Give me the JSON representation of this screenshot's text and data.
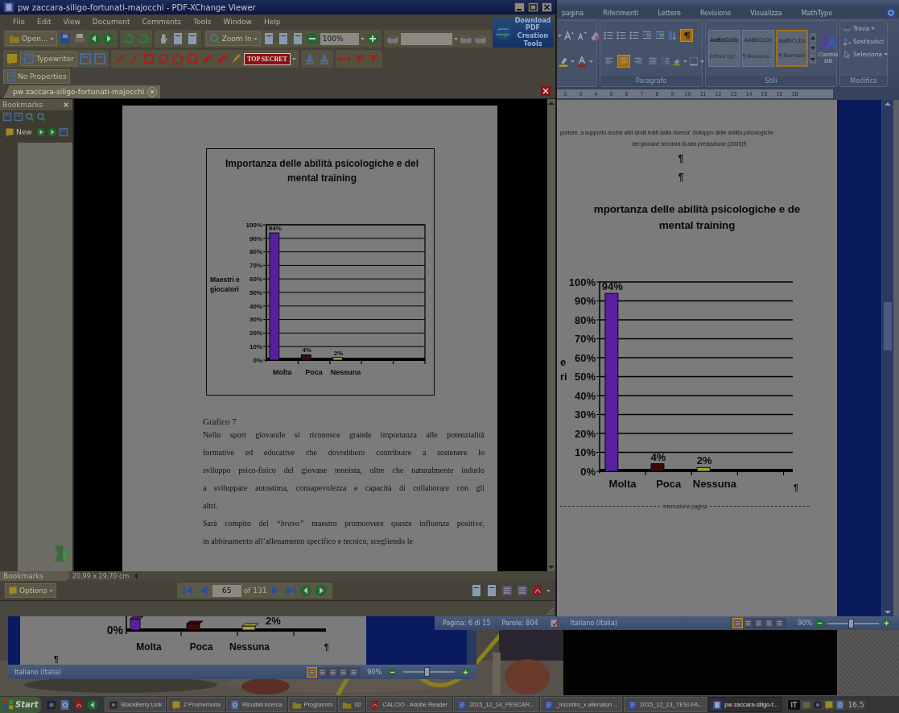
{
  "pdf_viewer": {
    "title": "pw zaccara-siligo-fortunati-majocchi - PDF-XChange Viewer",
    "menu": [
      "File",
      "Edit",
      "View",
      "Document",
      "Comments",
      "Tools",
      "Window",
      "Help"
    ],
    "open_button": "Open...",
    "zoom_button": "Zoom In",
    "zoom_value": "100%",
    "typewriter_button": "Typewriter",
    "stamp_button": "TOP SECRET",
    "properties_button": "No Properties",
    "promo": "Download PDF Creation Tools",
    "tabs": [
      {
        "label": "pw zaccara-siligo-fortunati-majocchi",
        "selected": true
      }
    ],
    "bookmarks": {
      "title": "Bookmarks",
      "new_button": "New",
      "tab": "Bookmarks"
    },
    "page": {
      "chart_data": {
        "type": "bar",
        "grid": true,
        "title": "Importanza delle abilità psicologiche e del\nmental training",
        "ylabel": "Maestri e\ngiocatori",
        "categories": [
          "Molta",
          "Poca",
          "Nessuna"
        ],
        "values": [
          94,
          4,
          2
        ],
        "colors": [
          "#5a1fa0",
          "#3c0a0a",
          "#a8a040"
        ],
        "ylim": [
          0,
          100
        ],
        "yticks": [
          {
            "value": 0,
            "label": "0%"
          },
          {
            "value": 10,
            "label": "10%"
          },
          {
            "value": 20,
            "label": "20%"
          },
          {
            "value": 30,
            "label": "30%"
          },
          {
            "value": 40,
            "label": "40%"
          },
          {
            "value": 50,
            "label": "50%"
          },
          {
            "value": 60,
            "label": "60%"
          },
          {
            "value": 70,
            "label": "70%"
          },
          {
            "value": 80,
            "label": "80%"
          },
          {
            "value": 90,
            "label": "90%"
          },
          {
            "value": 100,
            "label": "100%"
          }
        ],
        "value_labels": [
          "94%",
          "4%",
          "2%"
        ]
      },
      "caption": "Grafico 7",
      "paragraphs": [
        {
          "lines": [
            "Nello sport giovanile si riconosce grande importanza alle potenzialità",
            "formative ed educative che dovrebbero contribuire a sostenere lo",
            "sviluppo psico-fisico del giovane tennista, oltre che naturalmente indurlo",
            "a sviluppare autostima, consapevolezza e capacità di collaborare con gli",
            "altri."
          ]
        },
        {
          "lines": [
            "Sarà compito del *“bravo”* maestro promuovere queste influenze positive,",
            "in abbinamento all’allenamento specifico e tecnico, scegliendo le"
          ]
        }
      ]
    },
    "page_size": "20,99 x 29,70 cm",
    "options_button": "Options",
    "page_number": "65",
    "page_count": "of 131"
  },
  "word": {
    "tabs": [
      {
        "label": "pagina",
        "selected": false
      },
      {
        "label": "Riferimenti",
        "selected": false
      },
      {
        "label": "Lettere",
        "selected": false
      },
      {
        "label": "Revisione",
        "selected": false
      },
      {
        "label": "Visualizza",
        "selected": false
      },
      {
        "label": "MathType",
        "selected": false
      }
    ],
    "formatting_marks": {
      "on": true
    },
    "alignment": [
      {
        "kind": "left",
        "selected": false
      },
      {
        "kind": "center",
        "selected": true
      },
      {
        "kind": "right",
        "selected": false
      },
      {
        "kind": "justify",
        "selected": false
      }
    ],
    "groups": [
      "Paragrafo",
      "Stili",
      "Modifica"
    ],
    "styles": [
      {
        "preview": "AaBbCcDc",
        "name": "Enfasi (gr...",
        "bold": true,
        "selected": false
      },
      {
        "preview": "AaBbCcDc",
        "name": "¶ Nessuna...",
        "bold": false,
        "selected": false
      },
      {
        "preview": "AaBbCcDc",
        "name": "¶ Normale",
        "bold": false,
        "selected": true
      }
    ],
    "change_styles": "Cambia stili",
    "editing": [
      "Trova",
      "Sostituisci",
      "Seleziona"
    ],
    "ruler": [
      "2",
      "3",
      "4",
      "5",
      "6",
      "7",
      "8",
      "9",
      "10",
      "11",
      "12",
      "13",
      "14",
      "15",
      "16",
      "18"
    ],
    "document": {
      "intro": [
        "portare, a supporto anche altri simili tratti dalla ricerca” Sviluppo delle abilità psicologiche",
        "del giovane tennista di alta prestazione (2005)¶"
      ],
      "marks": [
        "¶",
        "¶"
      ],
      "chart_data": {
        "type": "bar",
        "grid": true,
        "title": "mportanza delle abilità psicologiche e de\nmental training",
        "ylabel": "e\nri",
        "categories": [
          "Molta",
          "Poca",
          "Nessuna"
        ],
        "values": [
          94,
          4,
          2
        ],
        "colors": [
          "#5a1fa0",
          "#3c0a0a",
          "#a8a040"
        ],
        "ylim": [
          0,
          100
        ],
        "yticks": [
          {
            "value": 0,
            "label": "0%"
          },
          {
            "value": 10,
            "label": "10%"
          },
          {
            "value": 20,
            "label": "20%"
          },
          {
            "value": 30,
            "label": "30%"
          },
          {
            "value": 40,
            "label": "40%"
          },
          {
            "value": 50,
            "label": "50%"
          },
          {
            "value": 60,
            "label": "60%"
          },
          {
            "value": 70,
            "label": "70%"
          },
          {
            "value": 80,
            "label": "80%"
          },
          {
            "value": 90,
            "label": "90%"
          },
          {
            "value": 100,
            "label": "100%"
          }
        ],
        "value_labels": [
          "94%",
          "4%",
          "2%"
        ]
      },
      "end_mark": "¶",
      "page_break": "interruzione pagina"
    },
    "status": {
      "page": "Pagina: 6 di 15",
      "words": "Parole: 804",
      "language": "Italiano (Italia)",
      "zoom": {
        "label": "90%",
        "level": 0.45
      }
    }
  },
  "background_document": {
    "tick_label": "0%",
    "value_label": "2%",
    "categories": [
      "Molta",
      "Poca",
      "Nessuna"
    ],
    "marks": [
      "¶",
      "¶"
    ],
    "language": "Italiano (Italia)",
    "zoom": {
      "label": "90%",
      "level": 0.45
    }
  },
  "taskbar": {
    "start": "Start",
    "tasks": [
      {
        "label": "BlackBerry Link",
        "kind": "app",
        "selected": false
      },
      {
        "label": "2 Promemoria",
        "kind": "note",
        "selected": false
      },
      {
        "label": "Risultati ricerca",
        "kind": "search",
        "selected": false
      },
      {
        "label": "Programmi",
        "kind": "folder",
        "selected": false
      },
      {
        "label": "00",
        "kind": "folder",
        "selected": false
      },
      {
        "label": "CALCIO - Adobe Reader",
        "kind": "pdf",
        "selected": false
      },
      {
        "label": "2015_12_14_PESCAR...",
        "kind": "doc",
        "selected": false
      },
      {
        "label": "_incontro_x allenatori ...",
        "kind": "doc",
        "selected": false
      },
      {
        "label": "2015_12_13_TESI-FA...",
        "kind": "doc",
        "selected": false
      },
      {
        "label": "pw zaccara-siligo-f...",
        "kind": "viewer",
        "selected": true
      }
    ],
    "language": "IT",
    "clock": "16.5"
  }
}
